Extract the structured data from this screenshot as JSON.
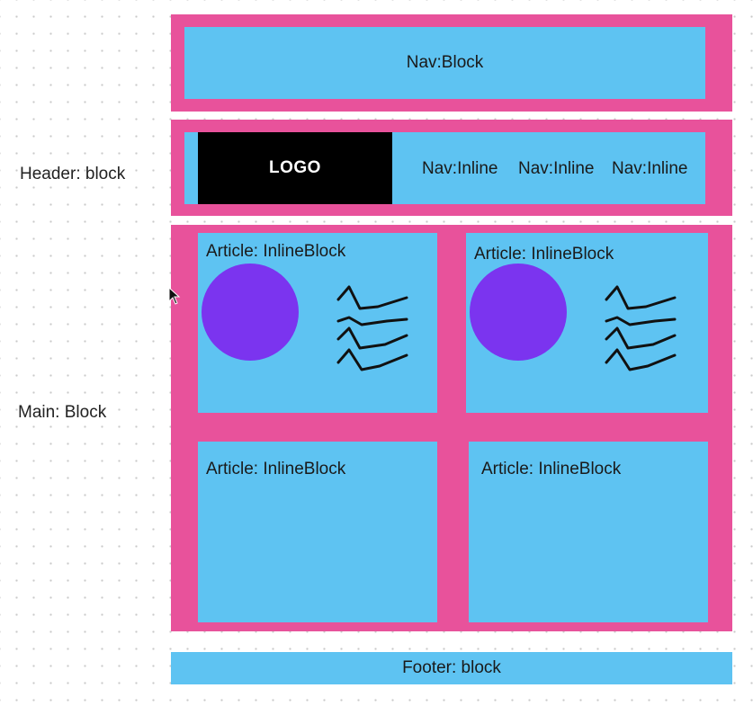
{
  "labels": {
    "header": "Header: block",
    "main": "Main: Block"
  },
  "top_nav": {
    "label": "Nav:Block"
  },
  "header": {
    "logo": "LOGO",
    "nav_items": [
      "Nav:Inline",
      "Nav:Inline",
      "Nav:Inline"
    ]
  },
  "main": {
    "articles": [
      {
        "label": "Article: InlineBlock"
      },
      {
        "label": "Article: InlineBlock"
      },
      {
        "label": "Article: InlineBlock"
      },
      {
        "label": "Article: InlineBlock"
      }
    ]
  },
  "footer": {
    "label": "Footer: block"
  },
  "colors": {
    "container": "#e8529b",
    "block": "#5ec3f2",
    "logo_bg": "#000000",
    "image_circle": "#7b34ef"
  },
  "icons": {
    "article_image": "circle-image-placeholder",
    "article_text": "scribble-text-lines",
    "pointer": "mouse-cursor-icon"
  }
}
